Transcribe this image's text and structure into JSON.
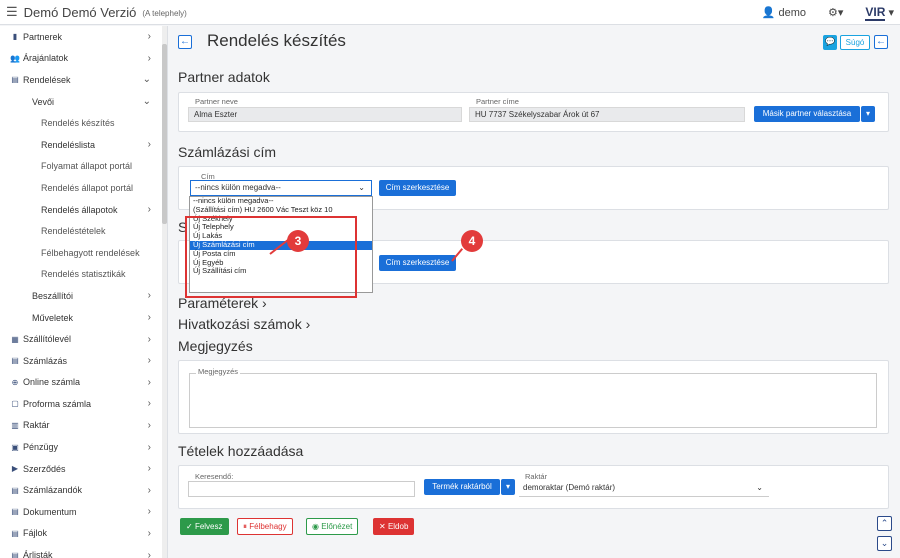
{
  "app": {
    "title": "Demó Demó Verzió",
    "subtitle": "(A telephely)",
    "user": "demo",
    "logo": "VIR"
  },
  "sidebar": {
    "items": [
      {
        "label": "Partnerek",
        "icon": "building-icon",
        "level": 0,
        "chev": "›"
      },
      {
        "label": "Árajánlatok",
        "icon": "users-icon",
        "level": 0,
        "chev": "›"
      },
      {
        "label": "Rendelések",
        "icon": "file-icon",
        "level": 0,
        "chev": "⌄"
      },
      {
        "label": "Vevői",
        "icon": "",
        "level": 1,
        "chev": "⌄"
      },
      {
        "label": "Rendelés készítés",
        "icon": "",
        "level": 2,
        "chev": ""
      },
      {
        "label": "Rendeléslista",
        "icon": "",
        "level": 3,
        "chev": "›"
      },
      {
        "label": "Folyamat állapot portál",
        "icon": "",
        "level": 2,
        "chev": ""
      },
      {
        "label": "Rendelés állapot portál",
        "icon": "",
        "level": 2,
        "chev": ""
      },
      {
        "label": "Rendelés állapotok",
        "icon": "",
        "level": 3,
        "chev": "›"
      },
      {
        "label": "Rendeléstételek",
        "icon": "",
        "level": 2,
        "chev": ""
      },
      {
        "label": "Félbehagyott rendelések",
        "icon": "",
        "level": 2,
        "chev": ""
      },
      {
        "label": "Rendelés statisztikák",
        "icon": "",
        "level": 2,
        "chev": ""
      },
      {
        "label": "Beszállítói",
        "icon": "",
        "level": 1,
        "chev": "›"
      },
      {
        "label": "Műveletek",
        "icon": "",
        "level": 1,
        "chev": "›"
      },
      {
        "label": "Szállítólevél",
        "icon": "truck-icon",
        "level": 0,
        "chev": "›"
      },
      {
        "label": "Számlázás",
        "icon": "invoice-icon",
        "level": 0,
        "chev": "›"
      },
      {
        "label": "Online számla",
        "icon": "globe-icon",
        "level": 0,
        "chev": "›"
      },
      {
        "label": "Proforma számla",
        "icon": "doc-icon",
        "level": 0,
        "chev": "›"
      },
      {
        "label": "Raktár",
        "icon": "warehouse-icon",
        "level": 0,
        "chev": "›"
      },
      {
        "label": "Pénzügy",
        "icon": "money-icon",
        "level": 0,
        "chev": "›"
      },
      {
        "label": "Szerződés",
        "icon": "contract-icon",
        "level": 0,
        "chev": "›"
      },
      {
        "label": "Számlázandók",
        "icon": "stack-icon",
        "level": 0,
        "chev": "›"
      },
      {
        "label": "Dokumentum",
        "icon": "document-icon",
        "level": 0,
        "chev": "›"
      },
      {
        "label": "Fájlok",
        "icon": "folder-icon",
        "level": 0,
        "chev": "›"
      },
      {
        "label": "Árlisták",
        "icon": "tag-icon",
        "level": 0,
        "chev": "›"
      }
    ]
  },
  "page": {
    "title": "Rendelés készítés",
    "help": "Súgó"
  },
  "partner": {
    "section": "Partner adatok",
    "name_label": "Partner neve",
    "name": "Alma Eszter",
    "address_label": "Partner címe",
    "address": "HU 7737 Székelyszabar Árok út 67",
    "choose_btn": "Másik partner választása"
  },
  "billing": {
    "section": "Számlázási cím",
    "field_label": "Cím",
    "selected": "--nincs külön megadva--",
    "edit_btn": "Cím szerkesztése"
  },
  "shipping": {
    "section": "S",
    "edit_btn": "Cím szerkesztése"
  },
  "dropdown": {
    "options": [
      "--nincs külön megadva--",
      "(Szállítási cím) HU 2600 Vác Teszt köz 10",
      "Új Székhely",
      "Új Telephely",
      "Új Lakás",
      "Új Számlázási cím",
      "Új Posta cím",
      "Új Egyéb",
      "Új Szállítási cím"
    ],
    "highlighted": 5
  },
  "annotations": {
    "badge3": "3",
    "badge4": "4",
    "color": "#e23b3b"
  },
  "params": {
    "title": "Paraméterek",
    "refs": "Hivatkozási számok"
  },
  "notes": {
    "section": "Megjegyzés",
    "label": "Megjegyzés"
  },
  "items": {
    "section": "Tételek hozzáadása",
    "search_label": "Keresendő:",
    "product_btn": "Termék raktárból",
    "warehouse_label": "Raktár",
    "warehouse": "demoraktar (Demó raktár)"
  },
  "actions": {
    "save": "Felvesz",
    "abandon": "Félbehagy",
    "preview": "Előnézet",
    "discard": "Eldob"
  }
}
